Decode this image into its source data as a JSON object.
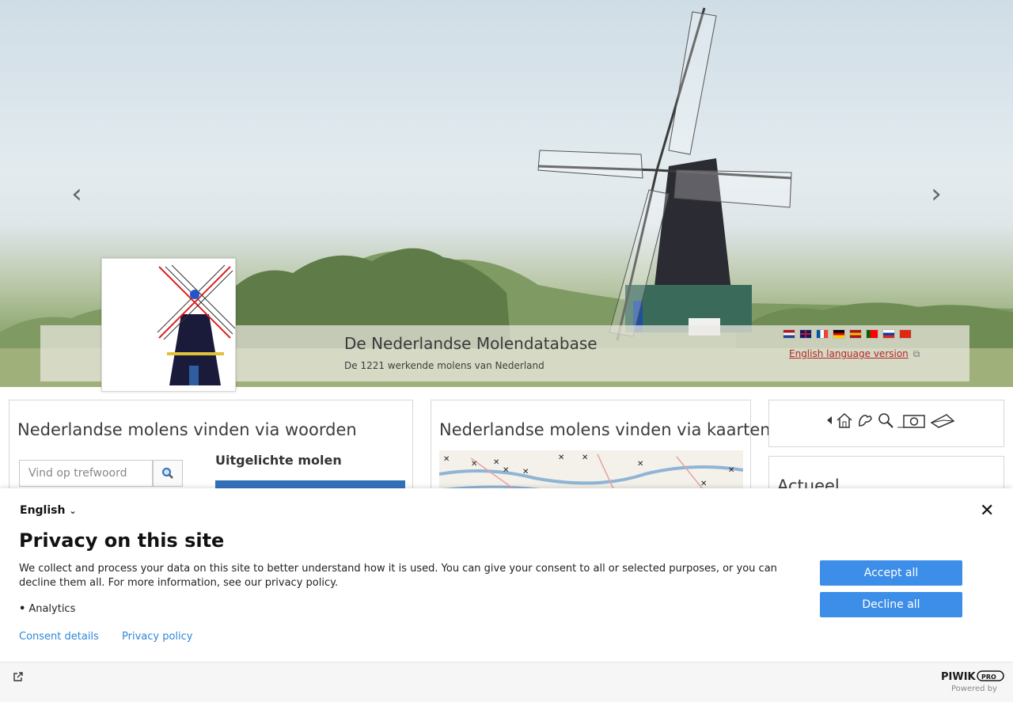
{
  "hero": {
    "prev_label": "‹",
    "next_label": "›",
    "site_title": "De Nederlandse Molendatabase",
    "site_subtitle": "De 1221 werkende molens van Nederland",
    "english_link": "English language version",
    "flags": [
      {
        "name": "flag-nl",
        "colors": [
          "#ae1c28",
          "#ffffff",
          "#21468b"
        ],
        "kind": "h"
      },
      {
        "name": "flag-uk",
        "colors": [
          "#012169",
          "#ffffff",
          "#c8102e"
        ],
        "kind": "uk"
      },
      {
        "name": "flag-fr",
        "colors": [
          "#0055a4",
          "#ffffff",
          "#ef4135"
        ],
        "kind": "v"
      },
      {
        "name": "flag-de",
        "colors": [
          "#000000",
          "#dd0000",
          "#ffce00"
        ],
        "kind": "h"
      },
      {
        "name": "flag-es",
        "colors": [
          "#aa151b",
          "#f1bf00",
          "#aa151b"
        ],
        "kind": "h"
      },
      {
        "name": "flag-pt",
        "colors": [
          "#006600",
          "#ff0000",
          "#ff0000"
        ],
        "kind": "v"
      },
      {
        "name": "flag-ru",
        "colors": [
          "#ffffff",
          "#0039a6",
          "#d52b1e"
        ],
        "kind": "h"
      },
      {
        "name": "flag-cn",
        "colors": [
          "#de2910",
          "#de2910",
          "#de2910"
        ],
        "kind": "h"
      }
    ]
  },
  "words_panel": {
    "heading": "Nederlandse molens vinden via woorden",
    "search_placeholder": "Vind op trefwoord",
    "featured_heading": "Uitgelichte molen"
  },
  "maps_panel": {
    "heading": "Nederlandse molens vinden via kaarten"
  },
  "nav_icons": [
    "back-arrow-icon",
    "home-icon",
    "map-icon",
    "search-icon",
    "camera-icon",
    "mail-icon"
  ],
  "actueel_panel": {
    "heading": "Actueel"
  },
  "consent": {
    "language": "English",
    "title": "Privacy on this site",
    "body": "We collect and process your data on this site to better understand how it is used. You can give your consent to all or selected purposes, or you can decline them all. For more information, see our privacy policy.",
    "purposes": [
      "Analytics"
    ],
    "accept_label": "Accept all",
    "decline_label": "Decline all",
    "details_link": "Consent details",
    "policy_link": "Privacy policy",
    "brand": "PIWIK PRO",
    "powered_by": "Powered by"
  },
  "colors": {
    "accent_button": "#3d8ee8",
    "link_blue": "#2f86d8",
    "english_link_red": "#b4272e"
  }
}
